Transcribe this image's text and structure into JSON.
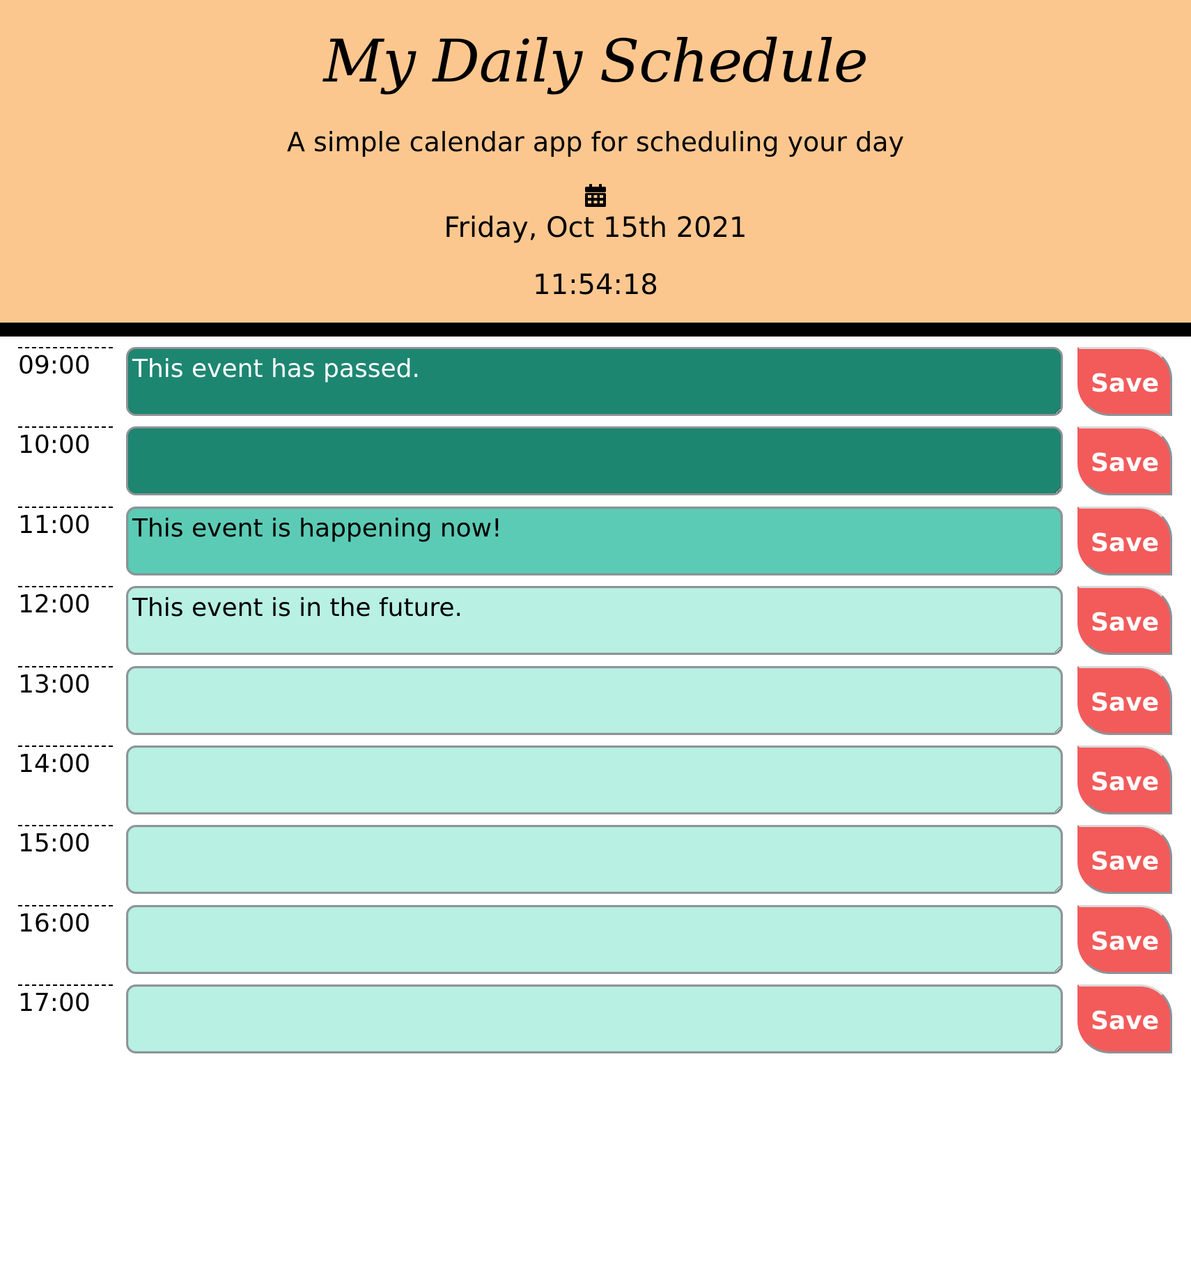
{
  "header": {
    "title": "My Daily Schedule",
    "subtitle": "A simple calendar app for scheduling your day",
    "icon": "calendar-icon",
    "date": "Friday, Oct 15th 2021",
    "time": "11:54:18",
    "background": "#fcc78f"
  },
  "colors": {
    "past": "#1d8671",
    "present": "#5ccbb5",
    "future": "#b8f0e4",
    "save": "#f35a5a"
  },
  "rows": [
    {
      "hour": "09:00",
      "status": "past",
      "text": "This event has passed.",
      "save_label": "Save"
    },
    {
      "hour": "10:00",
      "status": "past",
      "text": "",
      "save_label": "Save"
    },
    {
      "hour": "11:00",
      "status": "present",
      "text": "This event is happening now!",
      "save_label": "Save"
    },
    {
      "hour": "12:00",
      "status": "future",
      "text": "This event is in the future.",
      "save_label": "Save"
    },
    {
      "hour": "13:00",
      "status": "future",
      "text": "",
      "save_label": "Save"
    },
    {
      "hour": "14:00",
      "status": "future",
      "text": "",
      "save_label": "Save"
    },
    {
      "hour": "15:00",
      "status": "future",
      "text": "",
      "save_label": "Save"
    },
    {
      "hour": "16:00",
      "status": "future",
      "text": "",
      "save_label": "Save"
    },
    {
      "hour": "17:00",
      "status": "future",
      "text": "",
      "save_label": "Save"
    }
  ]
}
